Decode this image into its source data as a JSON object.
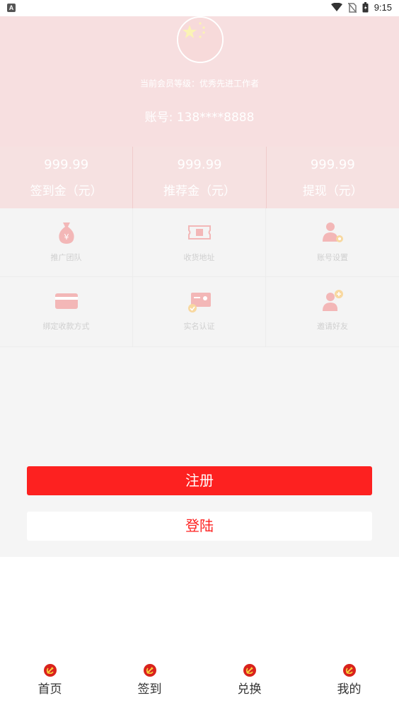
{
  "status_bar": {
    "time": "9:15",
    "app_badge": "A"
  },
  "profile": {
    "member_level": "当前会员等级：优秀先进工作者",
    "account": "账号: 138****8888"
  },
  "stats": [
    {
      "value": "999.99",
      "label": "签到金（元）"
    },
    {
      "value": "999.99",
      "label": "推荐金（元）"
    },
    {
      "value": "999.99",
      "label": "提现（元）"
    }
  ],
  "grid": [
    {
      "label": "推广团队",
      "icon": "money-bag-icon"
    },
    {
      "label": "收货地址",
      "icon": "ticket-icon"
    },
    {
      "label": "账号设置",
      "icon": "user-settings-icon"
    },
    {
      "label": "绑定收款方式",
      "icon": "card-icon"
    },
    {
      "label": "实名认证",
      "icon": "id-verify-icon"
    },
    {
      "label": "邀请好友",
      "icon": "invite-friend-icon"
    }
  ],
  "buttons": {
    "register": "注册",
    "login": "登陆"
  },
  "tabs": [
    {
      "label": "首页"
    },
    {
      "label": "签到"
    },
    {
      "label": "兑换"
    },
    {
      "label": "我的"
    }
  ],
  "colors": {
    "accent": "#fd2120",
    "header_bg": "#f7dfe0"
  }
}
